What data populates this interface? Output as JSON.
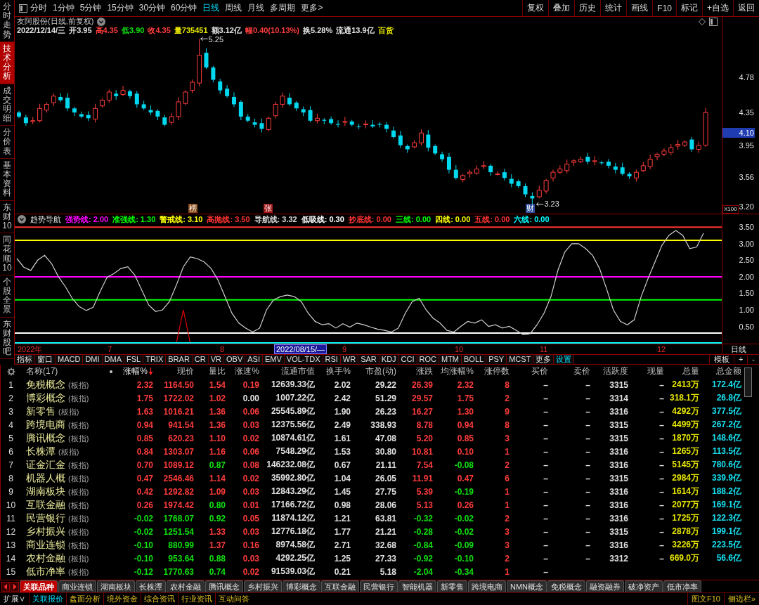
{
  "side_tabs": [
    {
      "label": "分时走势",
      "selected": false
    },
    {
      "label": "技术分析",
      "selected": true
    },
    {
      "label": "成交明细",
      "selected": false
    },
    {
      "label": "分价表",
      "selected": false
    },
    {
      "label": "基本资料",
      "selected": false
    },
    {
      "label": "东财10",
      "selected": false
    },
    {
      "label": "同花顺10",
      "selected": false
    },
    {
      "label": "个股全景",
      "selected": false
    },
    {
      "label": "东财股吧",
      "selected": false
    }
  ],
  "toolbar": {
    "periods": [
      {
        "label": "分时",
        "selected": false
      },
      {
        "label": "1分钟",
        "selected": false
      },
      {
        "label": "5分钟",
        "selected": false
      },
      {
        "label": "15分钟",
        "selected": false
      },
      {
        "label": "30分钟",
        "selected": false
      },
      {
        "label": "60分钟",
        "selected": false
      },
      {
        "label": "日线",
        "selected": true
      },
      {
        "label": "周线",
        "selected": false
      },
      {
        "label": "月线",
        "selected": false
      },
      {
        "label": "多周期",
        "selected": false
      },
      {
        "label": "更多>",
        "selected": false
      }
    ],
    "actions": [
      "复权",
      "叠加",
      "历史",
      "统计",
      "画线",
      "F10",
      "标记",
      "+自选",
      "返回"
    ]
  },
  "quote": {
    "title": "友阿股份(日线,前复权)",
    "fields": [
      {
        "text": "2022/12/14/三",
        "color": "#e0e0e0"
      },
      {
        "text": "开3.95",
        "color": "#e0e0e0"
      },
      {
        "text": "高4.35",
        "color": "#ff3c3c"
      },
      {
        "text": "低3.90",
        "color": "#10e010"
      },
      {
        "text": "收4.35",
        "color": "#ff3c3c"
      },
      {
        "text": "量735451",
        "color": "#e6e600"
      },
      {
        "text": "额3.12亿",
        "color": "#e0e0e0"
      },
      {
        "text": "幅0.40(10.13%)",
        "color": "#ff3c3c"
      },
      {
        "text": "换5.28%",
        "color": "#e0e0e0"
      },
      {
        "text": "流通13.9亿",
        "color": "#e0e0e0"
      },
      {
        "text": "百货",
        "color": "#e6e600"
      }
    ]
  },
  "price_chart": {
    "high_label": "5.25",
    "low_label": "3.23",
    "markers": [
      {
        "text": "榜",
        "color": "#8a4a1a"
      },
      {
        "text": "张",
        "color": "#a01818"
      },
      {
        "text": "财",
        "color": "#2a4a9a"
      }
    ],
    "axis_labels": [
      {
        "text": "4.78",
        "current": false
      },
      {
        "text": "4.35",
        "current": false
      },
      {
        "text": "4.10",
        "current": true
      },
      {
        "text": "3.95",
        "current": false
      },
      {
        "text": "3.56",
        "current": false
      },
      {
        "text": "3.20",
        "current": false
      }
    ],
    "scale_label": "X100"
  },
  "indicator": {
    "title": "趋势导航",
    "legend": [
      {
        "text": "强势线: 2.00",
        "color": "#ff00ff"
      },
      {
        "text": "准强线: 1.30",
        "color": "#00ff00"
      },
      {
        "text": "警戒线: 3.10",
        "color": "#ffff00"
      },
      {
        "text": "高抛线: 3.50",
        "color": "#ff3232"
      },
      {
        "text": "导航线: 3.32",
        "color": "#d8d8d8"
      },
      {
        "text": "低吸线: 0.30",
        "color": "#ffffff"
      },
      {
        "text": "抄底线: 0.00",
        "color": "#ff3232"
      },
      {
        "text": "三线: 0.00",
        "color": "#00ff00"
      },
      {
        "text": "四线: 0.00",
        "color": "#ffff00"
      },
      {
        "text": "五线: 0.00",
        "color": "#ff3232"
      },
      {
        "text": "六线: 0.00",
        "color": "#00ffff"
      }
    ],
    "chart_data": {
      "type": "line",
      "ylim": [
        -0.02,
        3.59
      ],
      "yticks": [
        {
          "value": 3.5,
          "label": "3.50"
        },
        {
          "value": 3.0,
          "label": "3.00"
        },
        {
          "value": 2.5,
          "label": "2.50"
        },
        {
          "value": 2.0,
          "label": "2.00"
        },
        {
          "value": 1.5,
          "label": "1.50"
        },
        {
          "value": 1.0,
          "label": "1.00"
        },
        {
          "value": 0.5,
          "label": "0.50"
        }
      ],
      "series": [
        {
          "color": "#ff3232",
          "values": [
            3.5,
            3.5,
            3.5,
            3.5,
            3.5,
            3.5,
            3.5,
            3.5,
            3.5,
            3.5,
            3.5,
            3.5,
            3.5,
            3.5,
            3.5,
            3.5,
            3.5,
            3.5,
            3.5,
            3.5,
            3.5,
            3.5,
            3.5,
            3.5,
            3.5,
            3.5,
            3.5,
            3.5,
            3.5,
            3.5,
            3.5,
            3.5,
            3.5,
            3.5,
            3.5,
            3.5,
            3.5,
            3.5,
            3.5,
            3.5,
            3.5,
            3.5,
            3.5,
            3.5,
            3.5,
            3.5,
            3.5,
            3.5,
            3.5,
            3.5,
            3.5,
            3.5,
            3.5,
            3.5,
            3.5,
            3.5,
            3.5,
            3.5,
            3.5,
            3.5,
            3.5,
            3.5,
            3.5,
            3.5,
            3.5,
            3.5,
            3.5,
            3.5,
            3.5,
            3.5,
            3.5,
            3.5,
            3.5,
            3.5,
            3.5,
            3.5,
            3.5,
            3.5,
            3.5,
            3.5,
            3.5,
            3.5,
            3.5,
            3.5,
            3.5,
            3.5,
            3.5,
            3.5,
            3.5,
            3.5,
            3.5,
            3.5,
            3.5,
            3.5,
            3.5,
            3.5,
            3.5,
            3.5,
            3.5,
            3.5
          ]
        },
        {
          "color": "#ffff00",
          "values": [
            3.1,
            3.1,
            3.1,
            3.1,
            3.1,
            3.1,
            3.1,
            3.1,
            3.1,
            3.1,
            3.1,
            3.1,
            3.1,
            3.1,
            3.1,
            3.1,
            3.1,
            3.1,
            3.1,
            3.1,
            3.1,
            3.1,
            3.1,
            3.1,
            3.1,
            3.1,
            3.1,
            3.1,
            3.1,
            3.1,
            3.1,
            3.1,
            3.1,
            3.1,
            3.1,
            3.1,
            3.1,
            3.1,
            3.1,
            3.1,
            3.1,
            3.1,
            3.1,
            3.1,
            3.1,
            3.1,
            3.1,
            3.1,
            3.1,
            3.1,
            3.1,
            3.1,
            3.1,
            3.1,
            3.1,
            3.1,
            3.1,
            3.1,
            3.1,
            3.1,
            3.1,
            3.1,
            3.1,
            3.1,
            3.1,
            3.1,
            3.1,
            3.1,
            3.1,
            3.1,
            3.1,
            3.1,
            3.1,
            3.1,
            3.1,
            3.1,
            3.1,
            3.1,
            3.1,
            3.1,
            3.1,
            3.1,
            3.1,
            3.1,
            3.1,
            3.1,
            3.1,
            3.1,
            3.1,
            3.1,
            3.1,
            3.1,
            3.1,
            3.1,
            3.1,
            3.1,
            3.1,
            3.1,
            3.1,
            3.1
          ]
        },
        {
          "color": "#ff00ff",
          "values": [
            2,
            2,
            2,
            2,
            2,
            2,
            2,
            2,
            2,
            2,
            2,
            2,
            2,
            2,
            2,
            2,
            2,
            2,
            2,
            2,
            2,
            2,
            2,
            2,
            2,
            2,
            2,
            2,
            2,
            2,
            2,
            2,
            2,
            2,
            2,
            2,
            2,
            2,
            2,
            2,
            2,
            2,
            2,
            2,
            2,
            2,
            2,
            2,
            2,
            2,
            2,
            2,
            2,
            2,
            2,
            2,
            2,
            2,
            2,
            2,
            2,
            2,
            2,
            2,
            2,
            2,
            2,
            2,
            2,
            2,
            2,
            2,
            2,
            2,
            2,
            2,
            2,
            2,
            2,
            2,
            2,
            2,
            2,
            2,
            2,
            2,
            2,
            2,
            2,
            2,
            2,
            2,
            2,
            2,
            2,
            2,
            2,
            2,
            2,
            2
          ]
        },
        {
          "color": "#00ff00",
          "values": [
            1.3,
            1.3,
            1.3,
            1.3,
            1.3,
            1.3,
            1.3,
            1.3,
            1.3,
            1.3,
            1.3,
            1.3,
            1.3,
            1.3,
            1.3,
            1.3,
            1.3,
            1.3,
            1.3,
            1.3,
            1.3,
            1.3,
            1.3,
            1.3,
            1.3,
            1.3,
            1.3,
            1.3,
            1.3,
            1.3,
            1.3,
            1.3,
            1.3,
            1.3,
            1.3,
            1.3,
            1.3,
            1.3,
            1.3,
            1.3,
            1.3,
            1.3,
            1.3,
            1.3,
            1.3,
            1.3,
            1.3,
            1.3,
            1.3,
            1.3,
            1.3,
            1.3,
            1.3,
            1.3,
            1.3,
            1.3,
            1.3,
            1.3,
            1.3,
            1.3,
            1.3,
            1.3,
            1.3,
            1.3,
            1.3,
            1.3,
            1.3,
            1.3,
            1.3,
            1.3,
            1.3,
            1.3,
            1.3,
            1.3,
            1.3,
            1.3,
            1.3,
            1.3,
            1.3,
            1.3,
            1.3,
            1.3,
            1.3,
            1.3,
            1.3,
            1.3,
            1.3,
            1.3,
            1.3,
            1.3,
            1.3,
            1.3,
            1.3,
            1.3,
            1.3,
            1.3,
            1.3,
            1.3,
            1.3,
            1.3
          ]
        },
        {
          "color": "#ffffff",
          "values": [
            0.3,
            0.3,
            0.3,
            0.3,
            0.3,
            0.3,
            0.3,
            0.3,
            0.3,
            0.3,
            0.3,
            0.3,
            0.3,
            0.3,
            0.3,
            0.3,
            0.3,
            0.3,
            0.3,
            0.3,
            0.3,
            0.3,
            0.3,
            0.3,
            0.3,
            0.3,
            0.3,
            0.3,
            0.3,
            0.3,
            0.3,
            0.3,
            0.3,
            0.3,
            0.3,
            0.3,
            0.3,
            0.3,
            0.3,
            0.3,
            0.3,
            0.3,
            0.3,
            0.3,
            0.3,
            0.3,
            0.3,
            0.3,
            0.3,
            0.3,
            0.3,
            0.3,
            0.3,
            0.3,
            0.3,
            0.3,
            0.3,
            0.3,
            0.3,
            0.3,
            0.3,
            0.3,
            0.3,
            0.3,
            0.3,
            0.3,
            0.3,
            0.3,
            0.3,
            0.3,
            0.3,
            0.3,
            0.3,
            0.3,
            0.3,
            0.3,
            0.3,
            0.3,
            0.3,
            0.3,
            0.3,
            0.3,
            0.3,
            0.3,
            0.3,
            0.3,
            0.3,
            0.3,
            0.3,
            0.3,
            0.3,
            0.3,
            0.3,
            0.3,
            0.3,
            0.3,
            0.3,
            0.3,
            0.3,
            0.3
          ]
        },
        {
          "color": "#e00000",
          "values": [
            null,
            null,
            null,
            null,
            null,
            null,
            null,
            null,
            null,
            null,
            null,
            null,
            null,
            null,
            null,
            null,
            null,
            null,
            null,
            null,
            null,
            null,
            null,
            0,
            1,
            0,
            null,
            null,
            null,
            null,
            null,
            null,
            null,
            null,
            null,
            null,
            null,
            null,
            null,
            null,
            null,
            null,
            null,
            null,
            null,
            null,
            null,
            null,
            null,
            null,
            null,
            null,
            null,
            null,
            null,
            null,
            null,
            null,
            null,
            null,
            null,
            null,
            null,
            null,
            null,
            null,
            null,
            null,
            null,
            null,
            null,
            null,
            null,
            null,
            null,
            null,
            null,
            null,
            null,
            null,
            null,
            null,
            null,
            null,
            null,
            null,
            null,
            null,
            null,
            null,
            null,
            null,
            null,
            null,
            null,
            null,
            null,
            null,
            null,
            null
          ]
        },
        {
          "color": "#00ffff",
          "values": [
            0,
            0,
            0,
            0,
            0,
            0,
            0,
            0,
            0,
            0,
            0,
            0,
            0,
            0,
            0,
            0,
            0,
            0,
            0,
            0,
            0,
            0,
            0,
            0,
            0,
            0,
            0,
            0,
            0,
            0,
            0,
            0,
            0,
            0,
            0,
            0,
            0,
            0,
            0,
            0,
            0,
            0,
            0,
            0,
            0,
            0,
            0,
            0,
            0,
            0,
            0,
            0,
            0,
            0,
            0,
            0,
            0,
            0,
            0,
            0,
            0,
            0,
            0,
            0,
            0,
            0,
            0,
            0,
            0,
            0,
            0,
            0,
            0,
            0,
            0,
            0,
            0,
            0,
            0,
            0,
            0,
            0,
            0,
            0,
            0,
            0,
            0,
            0,
            0,
            0,
            0,
            0,
            0,
            0,
            0,
            0,
            0,
            0,
            0,
            0
          ]
        },
        {
          "color": "#d0d0d0",
          "values": [
            2.55,
            2.29,
            2.19,
            2.5,
            2.65,
            2.4,
            2.0,
            1.7,
            1.34,
            1.1,
            0.98,
            1.08,
            1.55,
            1.98,
            2.1,
            2.25,
            2.3,
            2.05,
            1.6,
            1.15,
            0.95,
            1.0,
            1.25,
            1.75,
            2.3,
            2.6,
            2.55,
            2.45,
            2.25,
            1.9,
            1.4,
            0.9,
            0.6,
            0.45,
            0.33,
            0.45,
            1.0,
            1.3,
            1.4,
            1.45,
            1.4,
            1.25,
            0.9,
            0.65,
            0.55,
            0.58,
            0.45,
            0.58,
            0.48,
            0.6,
            0.55,
            0.48,
            0.42,
            0.38,
            0.33,
            0.45,
            0.9,
            1.25,
            1.35,
            1.0,
            0.75,
            0.6,
            0.38,
            0.33,
            0.5,
            0.65,
            0.6,
            0.7,
            0.5,
            0.55,
            0.45,
            0.5,
            0.38,
            0.25,
            0.28,
            0.55,
            0.9,
            1.4,
            2.2,
            2.75,
            3.0,
            3.0,
            2.85,
            2.65,
            2.25,
            1.65,
            1.0,
            0.65,
            0.55,
            0.7,
            1.4,
            1.95,
            2.45,
            2.95,
            3.25,
            3.4,
            3.25,
            2.85,
            2.9,
            3.32
          ]
        }
      ]
    }
  },
  "time_axis": {
    "labels": [
      {
        "text": "2022年",
        "highlight": false
      },
      {
        "text": "7",
        "highlight": false
      },
      {
        "text": "8",
        "highlight": false
      },
      {
        "text": "2022/08/15/—",
        "highlight": true
      },
      {
        "text": "9",
        "highlight": false
      },
      {
        "text": "10",
        "highlight": false
      },
      {
        "text": "11",
        "highlight": false
      },
      {
        "text": "12",
        "highlight": false
      }
    ],
    "period": "日线"
  },
  "indicator_tabs": {
    "tabs": [
      {
        "label": "指标",
        "kind": "plain"
      },
      {
        "label": "窗口",
        "kind": "plain"
      },
      {
        "label": "MACD",
        "kind": "plain"
      },
      {
        "label": "DMI",
        "kind": "plain"
      },
      {
        "label": "DMA",
        "kind": "plain"
      },
      {
        "label": "FSL",
        "kind": "plain"
      },
      {
        "label": "TRIX",
        "kind": "plain"
      },
      {
        "label": "BRAR",
        "kind": "plain"
      },
      {
        "label": "CR",
        "kind": "plain"
      },
      {
        "label": "VR",
        "kind": "plain"
      },
      {
        "label": "OBV",
        "kind": "plain"
      },
      {
        "label": "ASI",
        "kind": "plain"
      },
      {
        "label": "EMV",
        "kind": "plain"
      },
      {
        "label": "VOL-TDX",
        "kind": "plain"
      },
      {
        "label": "RSI",
        "kind": "plain"
      },
      {
        "label": "WR",
        "kind": "plain"
      },
      {
        "label": "SAR",
        "kind": "plain"
      },
      {
        "label": "KDJ",
        "kind": "plain"
      },
      {
        "label": "CCI",
        "kind": "plain"
      },
      {
        "label": "ROC",
        "kind": "plain"
      },
      {
        "label": "MTM",
        "kind": "plain"
      },
      {
        "label": "BOLL",
        "kind": "plain"
      },
      {
        "label": "PSY",
        "kind": "plain"
      },
      {
        "label": "MCST",
        "kind": "plain"
      },
      {
        "label": "更多",
        "kind": "plain"
      },
      {
        "label": "设置",
        "kind": "settings"
      }
    ],
    "actions": [
      "模板",
      "+",
      "-"
    ]
  },
  "table": {
    "columns": [
      {
        "label": "名称(17)",
        "sorted": false
      },
      {
        "label": "涨幅%",
        "sorted": true
      },
      {
        "label": "现价",
        "sorted": false
      },
      {
        "label": "量比",
        "sorted": false
      },
      {
        "label": "涨速%",
        "sorted": false
      },
      {
        "label": "流通市值",
        "sorted": false
      },
      {
        "label": "换手%",
        "sorted": false
      },
      {
        "label": "市盈(动)",
        "sorted": false
      },
      {
        "label": "涨跌",
        "sorted": false
      },
      {
        "label": "均涨幅%",
        "sorted": false
      },
      {
        "label": "涨停数",
        "sorted": false
      },
      {
        "label": "买价",
        "sorted": false
      },
      {
        "label": "卖价",
        "sorted": false
      },
      {
        "label": "活跃度",
        "sorted": false
      },
      {
        "label": "现量",
        "sorted": false
      },
      {
        "label": "总量",
        "sorted": false
      },
      {
        "label": "总金额",
        "sorted": false
      }
    ],
    "rows": [
      {
        "no": "1",
        "tag": "(板指)",
        "cells": [
          "免税概念",
          {
            "text": "2.32",
            "color": "#ff3c3c"
          },
          {
            "text": "1164.50",
            "color": "#ff3c3c"
          },
          {
            "text": "1.54",
            "color": "#ff3c3c"
          },
          {
            "text": "0.19",
            "color": "#ff3c3c"
          },
          "12639.33亿",
          "2.02",
          "29.22",
          {
            "text": "26.39",
            "color": "#ff3c3c"
          },
          {
            "text": "2.32",
            "color": "#ff3c3c"
          },
          "8",
          "–",
          "–",
          "3315",
          "–",
          "2413万",
          "172.4亿"
        ]
      },
      {
        "no": "2",
        "tag": "(板指)",
        "cells": [
          "博彩概念",
          {
            "text": "1.75",
            "color": "#ff3c3c"
          },
          {
            "text": "1722.02",
            "color": "#ff3c3c"
          },
          {
            "text": "1.02",
            "color": "#ff3c3c"
          },
          {
            "text": "0.00",
            "color": "#e0e0e0"
          },
          "1007.22亿",
          "2.42",
          "51.29",
          {
            "text": "29.57",
            "color": "#ff3c3c"
          },
          {
            "text": "1.75",
            "color": "#ff3c3c"
          },
          "2",
          "–",
          "–",
          "3314",
          "–",
          "318.1万",
          "26.8亿"
        ]
      },
      {
        "no": "3",
        "tag": "(板指)",
        "cells": [
          "新零售",
          {
            "text": "1.63",
            "color": "#ff3c3c"
          },
          {
            "text": "1016.21",
            "color": "#ff3c3c"
          },
          {
            "text": "1.36",
            "color": "#ff3c3c"
          },
          {
            "text": "0.06",
            "color": "#ff3c3c"
          },
          "25545.89亿",
          "1.90",
          "26.23",
          {
            "text": "16.27",
            "color": "#ff3c3c"
          },
          {
            "text": "1.30",
            "color": "#ff3c3c"
          },
          "9",
          "–",
          "–",
          "3316",
          "–",
          "4292万",
          "377.5亿"
        ]
      },
      {
        "no": "4",
        "tag": "(板指)",
        "cells": [
          "跨境电商",
          {
            "text": "0.94",
            "color": "#ff3c3c"
          },
          {
            "text": "941.54",
            "color": "#ff3c3c"
          },
          {
            "text": "1.36",
            "color": "#ff3c3c"
          },
          {
            "text": "0.03",
            "color": "#ff3c3c"
          },
          "12375.56亿",
          "2.49",
          "338.93",
          {
            "text": "8.78",
            "color": "#ff3c3c"
          },
          {
            "text": "0.94",
            "color": "#ff3c3c"
          },
          "8",
          "–",
          "–",
          "3315",
          "–",
          "4499万",
          "267.2亿"
        ]
      },
      {
        "no": "5",
        "tag": "(板指)",
        "cells": [
          "腾讯概念",
          {
            "text": "0.85",
            "color": "#ff3c3c"
          },
          {
            "text": "620.23",
            "color": "#ff3c3c"
          },
          {
            "text": "1.10",
            "color": "#ff3c3c"
          },
          {
            "text": "0.02",
            "color": "#ff3c3c"
          },
          "10874.61亿",
          "1.61",
          "47.08",
          {
            "text": "5.20",
            "color": "#ff3c3c"
          },
          {
            "text": "0.85",
            "color": "#ff3c3c"
          },
          "3",
          "–",
          "–",
          "3315",
          "–",
          "1870万",
          "148.6亿"
        ]
      },
      {
        "no": "6",
        "tag": "(板指)",
        "cells": [
          "长株潭",
          {
            "text": "0.84",
            "color": "#ff3c3c"
          },
          {
            "text": "1303.07",
            "color": "#ff3c3c"
          },
          {
            "text": "1.16",
            "color": "#ff3c3c"
          },
          {
            "text": "0.06",
            "color": "#ff3c3c"
          },
          "7548.29亿",
          "1.53",
          "30.80",
          {
            "text": "10.81",
            "color": "#ff3c3c"
          },
          {
            "text": "0.10",
            "color": "#ff3c3c"
          },
          "1",
          "–",
          "–",
          "3316",
          "–",
          "1265万",
          "113.5亿"
        ]
      },
      {
        "no": "7",
        "tag": "(板指)",
        "cells": [
          "证金汇金",
          {
            "text": "0.70",
            "color": "#ff3c3c"
          },
          {
            "text": "1089.12",
            "color": "#ff3c3c"
          },
          {
            "text": "0.87",
            "color": "#10e010"
          },
          {
            "text": "0.08",
            "color": "#ff3c3c"
          },
          "146232.08亿",
          "0.67",
          "21.11",
          {
            "text": "7.54",
            "color": "#ff3c3c"
          },
          {
            "text": "-0.08",
            "color": "#10e010"
          },
          "2",
          "–",
          "–",
          "3316",
          "–",
          "5145万",
          "780.6亿"
        ]
      },
      {
        "no": "8",
        "tag": "(板指)",
        "cells": [
          "机器人概",
          {
            "text": "0.47",
            "color": "#ff3c3c"
          },
          {
            "text": "2546.46",
            "color": "#ff3c3c"
          },
          {
            "text": "1.14",
            "color": "#ff3c3c"
          },
          {
            "text": "0.02",
            "color": "#ff3c3c"
          },
          "35992.80亿",
          "1.04",
          "26.05",
          {
            "text": "11.91",
            "color": "#ff3c3c"
          },
          {
            "text": "0.47",
            "color": "#ff3c3c"
          },
          "6",
          "–",
          "–",
          "3315",
          "–",
          "2984万",
          "339.9亿"
        ]
      },
      {
        "no": "9",
        "tag": "(板指)",
        "cells": [
          "湖南板块",
          {
            "text": "0.42",
            "color": "#ff3c3c"
          },
          {
            "text": "1292.82",
            "color": "#ff3c3c"
          },
          {
            "text": "1.09",
            "color": "#ff3c3c"
          },
          {
            "text": "0.03",
            "color": "#ff3c3c"
          },
          "12843.29亿",
          "1.45",
          "27.75",
          {
            "text": "5.39",
            "color": "#ff3c3c"
          },
          {
            "text": "-0.19",
            "color": "#10e010"
          },
          "1",
          "–",
          "–",
          "3316",
          "–",
          "1614万",
          "188.2亿"
        ]
      },
      {
        "no": "10",
        "tag": "(板指)",
        "cells": [
          "互联金融",
          {
            "text": "0.26",
            "color": "#ff3c3c"
          },
          {
            "text": "1974.42",
            "color": "#ff3c3c"
          },
          {
            "text": "0.80",
            "color": "#10e010"
          },
          {
            "text": "0.01",
            "color": "#ff3c3c"
          },
          "17166.72亿",
          "0.98",
          "28.06",
          {
            "text": "5.13",
            "color": "#ff3c3c"
          },
          {
            "text": "0.26",
            "color": "#ff3c3c"
          },
          "1",
          "–",
          "–",
          "3316",
          "–",
          "2077万",
          "169.1亿"
        ]
      },
      {
        "no": "11",
        "tag": "(板指)",
        "cells": [
          "民营银行",
          {
            "text": "-0.02",
            "color": "#10e010"
          },
          {
            "text": "1768.07",
            "color": "#10e010"
          },
          {
            "text": "0.92",
            "color": "#10e010"
          },
          {
            "text": "0.05",
            "color": "#ff3c3c"
          },
          "11874.12亿",
          "1.21",
          "63.81",
          {
            "text": "-0.32",
            "color": "#10e010"
          },
          {
            "text": "-0.02",
            "color": "#10e010"
          },
          "2",
          "–",
          "–",
          "3316",
          "–",
          "1725万",
          "122.3亿"
        ]
      },
      {
        "no": "12",
        "tag": "(板指)",
        "cells": [
          "乡村振兴",
          {
            "text": "-0.02",
            "color": "#10e010"
          },
          {
            "text": "1251.54",
            "color": "#10e010"
          },
          {
            "text": "1.33",
            "color": "#ff3c3c"
          },
          {
            "text": "0.03",
            "color": "#ff3c3c"
          },
          "12776.18亿",
          "1.77",
          "21.21",
          {
            "text": "-0.28",
            "color": "#10e010"
          },
          {
            "text": "-0.02",
            "color": "#10e010"
          },
          "3",
          "–",
          "–",
          "3315",
          "–",
          "2878万",
          "199.1亿"
        ]
      },
      {
        "no": "13",
        "tag": "(板指)",
        "cells": [
          "商业连锁",
          {
            "text": "-0.10",
            "color": "#10e010"
          },
          {
            "text": "880.99",
            "color": "#10e010"
          },
          {
            "text": "1.37",
            "color": "#ff3c3c"
          },
          {
            "text": "0.16",
            "color": "#ff3c3c"
          },
          "8974.58亿",
          "2.71",
          "32.68",
          {
            "text": "-0.84",
            "color": "#10e010"
          },
          {
            "text": "-0.09",
            "color": "#10e010"
          },
          "3",
          "–",
          "–",
          "3316",
          "–",
          "3226万",
          "223.5亿"
        ]
      },
      {
        "no": "14",
        "tag": "(板指)",
        "cells": [
          "农村金融",
          {
            "text": "-0.10",
            "color": "#10e010"
          },
          {
            "text": "953.64",
            "color": "#10e010"
          },
          {
            "text": "0.88",
            "color": "#10e010"
          },
          {
            "text": "0.03",
            "color": "#ff3c3c"
          },
          "4292.25亿",
          "1.25",
          "27.33",
          {
            "text": "-0.92",
            "color": "#10e010"
          },
          {
            "text": "-0.10",
            "color": "#10e010"
          },
          "2",
          "–",
          "–",
          "3312",
          "–",
          "669.0万",
          "56.6亿"
        ]
      },
      {
        "no": "15",
        "tag": "(板指)",
        "cells": [
          "低市净率",
          {
            "text": "-0.12",
            "color": "#10e010"
          },
          {
            "text": "1770.63",
            "color": "#10e010"
          },
          {
            "text": "0.74",
            "color": "#10e010"
          },
          {
            "text": "0.02",
            "color": "#ff3c3c"
          },
          "91539.03亿",
          "0.21",
          "5.18",
          {
            "text": "-2.04",
            "color": "#10e010"
          },
          {
            "text": "-0.34",
            "color": "#10e010"
          },
          "1",
          "–"
        ]
      }
    ]
  },
  "related_tabs": [
    {
      "label": "关联品种",
      "selected": true
    },
    {
      "label": "商业连锁",
      "selected": false
    },
    {
      "label": "湖南板块",
      "selected": false
    },
    {
      "label": "长株潭",
      "selected": false
    },
    {
      "label": "农村金融",
      "selected": false
    },
    {
      "label": "腾讯概念",
      "selected": false
    },
    {
      "label": "乡村振兴",
      "selected": false
    },
    {
      "label": "博彩概念",
      "selected": false
    },
    {
      "label": "互联金融",
      "selected": false
    },
    {
      "label": "民营银行",
      "selected": false
    },
    {
      "label": "智能机器",
      "selected": false
    },
    {
      "label": "新零售",
      "selected": false
    },
    {
      "label": "跨境电商",
      "selected": false
    },
    {
      "label": "NMN概念",
      "selected": false
    },
    {
      "label": "免税概念",
      "selected": false
    },
    {
      "label": "融资融券",
      "selected": false
    },
    {
      "label": "破净资产",
      "selected": false
    },
    {
      "label": "低市净率",
      "selected": false
    }
  ],
  "info_tabs": {
    "expand": "扩展∨",
    "items": [
      {
        "label": "关联报价",
        "selected": true
      },
      {
        "label": "盘面分析",
        "selected": false
      },
      {
        "label": "境外资金",
        "selected": false
      },
      {
        "label": "综合资讯",
        "selected": false
      },
      {
        "label": "行业资讯",
        "selected": false
      },
      {
        "label": "互动问答",
        "selected": false
      }
    ],
    "actions": [
      "图文F10",
      "侧边栏»"
    ]
  }
}
